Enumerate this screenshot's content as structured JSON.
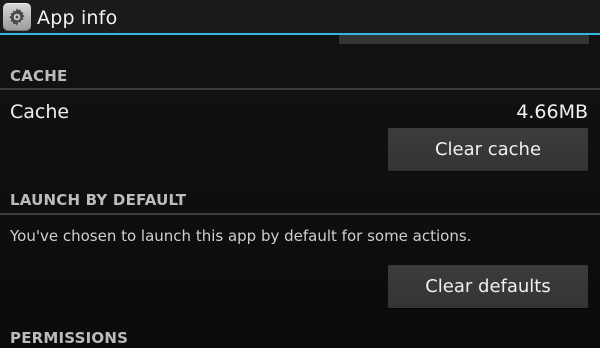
{
  "action_bar": {
    "title": "App info",
    "icon": "gear-icon",
    "accent_color": "#33b5e5"
  },
  "cache_section": {
    "header": "CACHE",
    "row_label": "Cache",
    "row_value": "4.66MB",
    "clear_button_label": "Clear cache"
  },
  "launch_section": {
    "header": "LAUNCH BY DEFAULT",
    "description": "You've chosen to launch this app by default for some actions.",
    "clear_button_label": "Clear defaults"
  },
  "permissions_section": {
    "header": "PERMISSIONS"
  }
}
